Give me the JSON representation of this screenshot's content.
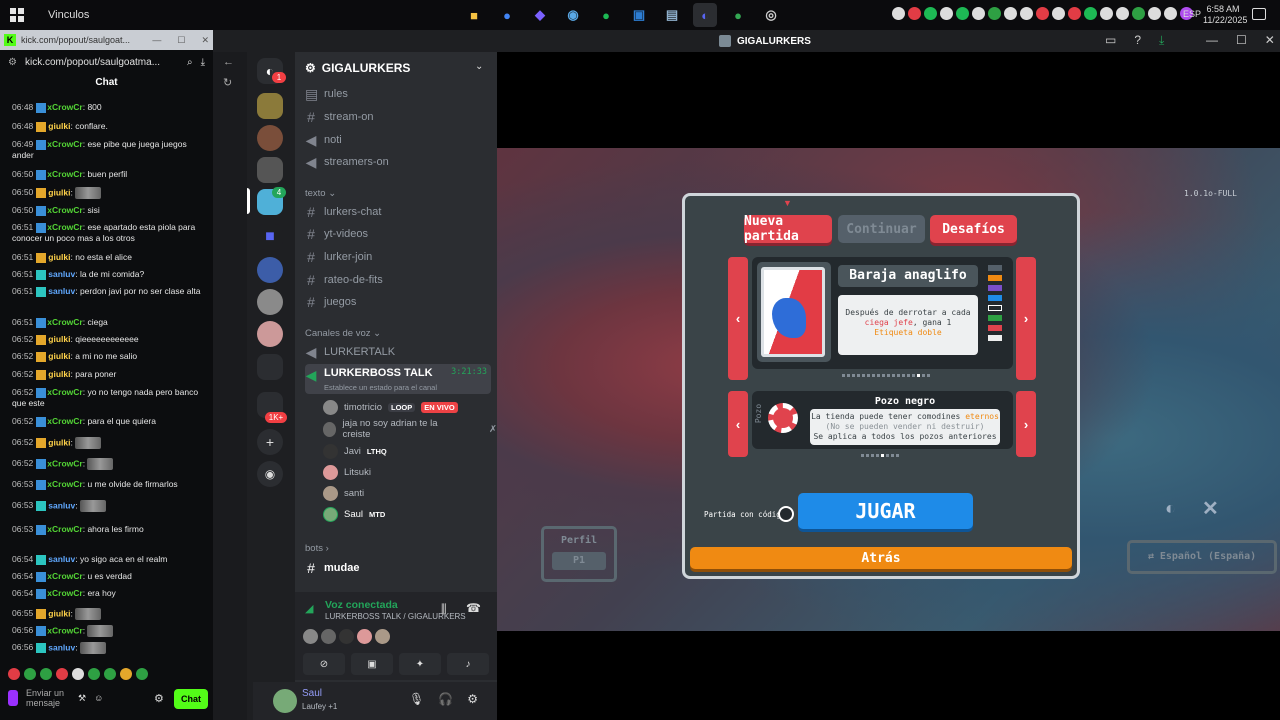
{
  "taskbar": {
    "window_title": "Vinculos",
    "apps": [
      {
        "name": "file-explorer",
        "color": "#f5c242"
      },
      {
        "name": "chrome",
        "color": "#4285f4"
      },
      {
        "name": "copilot",
        "color": "#7b61ff"
      },
      {
        "name": "steam",
        "color": "#1b6ea3"
      },
      {
        "name": "spotify",
        "color": "#1db954"
      },
      {
        "name": "store",
        "color": "#2d7dd2"
      },
      {
        "name": "files",
        "color": "#6c8fb0"
      },
      {
        "name": "discord",
        "color": "#5865f2"
      },
      {
        "name": "chrome-2",
        "color": "#34a853"
      },
      {
        "name": "obs",
        "color": "#333333"
      }
    ],
    "language": "ESP",
    "time": "6:58 AM",
    "date": "11/22/2025"
  },
  "kick": {
    "tab_url": "kick.com/popout/saulgoat...",
    "url": "kick.com/popout/saulgoatma...",
    "header": "Chat",
    "messages": [
      {
        "time": "06:48",
        "user": "xCrowCr",
        "text": "800",
        "cls": "cr",
        "b": "b1"
      },
      {
        "time": "06:48",
        "user": "giulki",
        "text": "conflare.",
        "cls": "gi",
        "b": "b2"
      },
      {
        "time": "06:49",
        "user": "xCrowCr",
        "text": "ese pibe que juega juegos ander",
        "cls": "cr",
        "b": "b1"
      },
      {
        "time": "06:50",
        "user": "xCrowCr",
        "text": "buen perfil",
        "cls": "cr",
        "b": "b1"
      },
      {
        "time": "06:50",
        "user": "giulki",
        "text": "",
        "cls": "gi",
        "b": "b2"
      },
      {
        "time": "06:50",
        "user": "xCrowCr",
        "text": "sisi",
        "cls": "cr",
        "b": "b1"
      },
      {
        "time": "06:51",
        "user": "xCrowCr",
        "text": "ese apartado esta piola para conocer un poco mas a los otros",
        "cls": "cr",
        "b": "b1"
      },
      {
        "time": "06:51",
        "user": "giulki",
        "text": "no esta el alice",
        "cls": "gi",
        "b": "b2"
      },
      {
        "time": "06:51",
        "user": "sanluv",
        "text": "la de mi comida?",
        "cls": "sa",
        "b": "b3"
      },
      {
        "time": "06:51",
        "user": "sanluv",
        "text": "perdon javi por no ser clase alta",
        "cls": "sa",
        "b": "b3"
      },
      {
        "time": "06:51",
        "user": "xCrowCr",
        "text": "ciega",
        "cls": "cr",
        "b": "b1"
      },
      {
        "time": "06:52",
        "user": "giulki",
        "text": "qieeeeeeeeeeee",
        "cls": "gi",
        "b": "b2"
      },
      {
        "time": "06:52",
        "user": "giulki",
        "text": "a mi no me salio",
        "cls": "gi",
        "b": "b2"
      },
      {
        "time": "06:52",
        "user": "giulki",
        "text": "para poner",
        "cls": "gi",
        "b": "b2"
      },
      {
        "time": "06:52",
        "user": "xCrowCr",
        "text": "yo no tengo nada pero banco que este",
        "cls": "cr",
        "b": "b1"
      },
      {
        "time": "06:52",
        "user": "xCrowCr",
        "text": "para el que quiera",
        "cls": "cr",
        "b": "b1"
      },
      {
        "time": "06:52",
        "user": "giulki",
        "text": "",
        "cls": "gi",
        "b": "b2"
      },
      {
        "time": "06:52",
        "user": "xCrowCr",
        "text": "",
        "cls": "cr",
        "b": "b1"
      },
      {
        "time": "06:53",
        "user": "xCrowCr",
        "text": "u me olvide de firmarlos",
        "cls": "cr",
        "b": "b1"
      },
      {
        "time": "06:53",
        "user": "sanluv",
        "text": "",
        "cls": "sa",
        "b": "b3"
      },
      {
        "time": "06:53",
        "user": "xCrowCr",
        "text": "ahora les firmo",
        "cls": "cr",
        "b": "b1"
      },
      {
        "time": "06:54",
        "user": "sanluv",
        "text": "yo sigo aca en el realm",
        "cls": "sa",
        "b": "b3"
      },
      {
        "time": "06:54",
        "user": "xCrowCr",
        "text": "u es verdad",
        "cls": "cr",
        "b": "b1"
      },
      {
        "time": "06:54",
        "user": "xCrowCr",
        "text": "era hoy",
        "cls": "cr",
        "b": "b1"
      },
      {
        "time": "06:55",
        "user": "giulki",
        "text": "",
        "cls": "gi",
        "b": "b2"
      },
      {
        "time": "06:56",
        "user": "xCrowCr",
        "text": "",
        "cls": "cr",
        "b": "b1"
      },
      {
        "time": "06:56",
        "user": "sanluv",
        "text": "",
        "cls": "sa",
        "b": "b3"
      }
    ],
    "input_placeholder": "Enviar un mensaje",
    "send_label": "Chat"
  },
  "discord": {
    "window_title": "GIGALURKERS",
    "server_name": "GIGALURKERS",
    "dm_badge": "1",
    "guild_badge_4": "4",
    "guild_badge_1k": "1K+",
    "top_channels": [
      "rules",
      "stream-on",
      "noti",
      "streamers-on"
    ],
    "cat_texto": "texto",
    "text_channels": [
      "lurkers-chat",
      "yt-videos",
      "lurker-join",
      "rateo-de-fits",
      "juegos"
    ],
    "cat_voz": "Canales de voz",
    "voice_channels": [
      {
        "name": "LURKERTALK"
      },
      {
        "name": "LURKERBOSS TALK",
        "timer": "3:21:33",
        "status": "Establece un estado para el canal"
      }
    ],
    "voice_users": [
      {
        "name": "timotricio",
        "tag": "LOOP",
        "live": "EN VIVO"
      },
      {
        "name": "jaja no soy adrian te la creiste"
      },
      {
        "name": "Javi",
        "tag": "LTHQ"
      },
      {
        "name": "Litsuki"
      },
      {
        "name": "santi"
      },
      {
        "name": "Saul",
        "tag": "MTD"
      }
    ],
    "cat_bots": "bots",
    "bot_channel": "mudae",
    "voice_connected": "Voz conectada",
    "voice_path": "LURKERBOSS TALK / GIGALURKERS",
    "user_name": "Saul",
    "user_status": "Laufey +1"
  },
  "game": {
    "version": "1.0.1o-FULL",
    "new_game": "Nueva partida",
    "continue": "Continuar",
    "challenges": "Desafíos",
    "deck_title": "Baraja anaglifo",
    "deck_desc_1": "Después de derrotar a cada",
    "deck_desc_hl1": "ciega jefe",
    "deck_desc_2": ", gana 1",
    "deck_desc_hl2": "Etiqueta doble",
    "stake_title": "Pozo negro",
    "stake_side_label": "Pozo",
    "stake_desc_1": "La tienda puede tener comodines",
    "stake_desc_hl": "eternos",
    "stake_desc_2": "(No se pueden vender ni destruir)",
    "stake_desc_3": "Se aplica a todos los pozos anteriores",
    "seeded_label": "Partida con códigos",
    "play": "JUGAR",
    "back": "Atrás",
    "profile_label": "Perfil",
    "profile_value": "P1",
    "language_label": "Español (España)"
  }
}
